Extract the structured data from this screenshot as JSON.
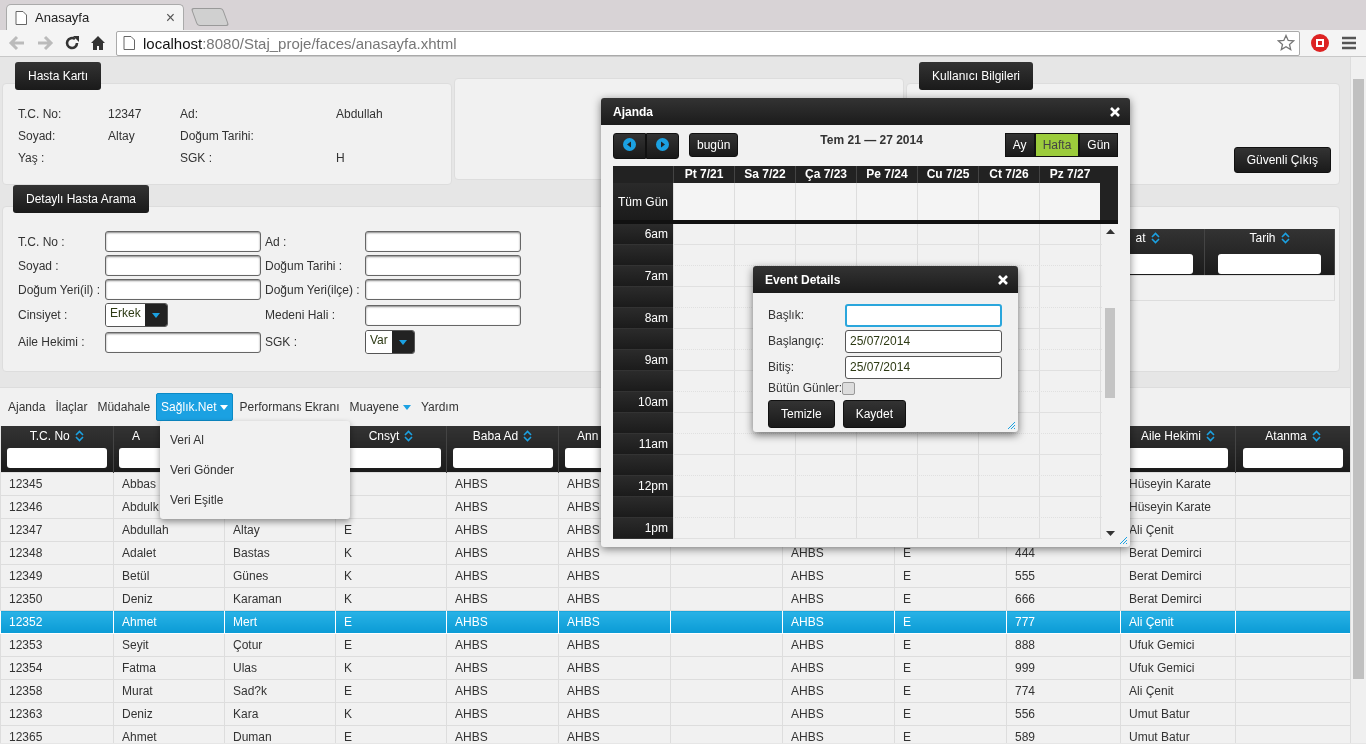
{
  "browser": {
    "tab": {
      "title": "Anasayfa",
      "close": "×"
    },
    "url": {
      "host": "localhost",
      "path": ":8080/Staj_proje/faces/anasayfa.xhtml"
    }
  },
  "patient_card": {
    "title": "Hasta Kartı",
    "fields": [
      {
        "label": "T.C. No:",
        "value": "12347"
      },
      {
        "label": "Ad:",
        "value": "Abdullah"
      },
      {
        "label": "Soyad:",
        "value": "Altay"
      },
      {
        "label": "Doğum Tarihi:"
      },
      {
        "label": "Yaş :"
      },
      {
        "label": "SGK :",
        "value": "H"
      }
    ]
  },
  "user_info": {
    "title": "Kullanıcı Bilgileri",
    "logout": "Güvenli Çıkış"
  },
  "search": {
    "title": "Detaylı Hasta Arama",
    "fields": [
      {
        "label": "T.C. No :",
        "kind": "text"
      },
      {
        "label": "Ad :",
        "kind": "text"
      },
      {
        "label": "Soyad :",
        "kind": "text"
      },
      {
        "label": "Doğum Tarihi :",
        "kind": "text"
      },
      {
        "label": "Doğum Yeri(il) :",
        "kind": "text"
      },
      {
        "label": "Doğum Yeri(ilçe) :",
        "kind": "text"
      },
      {
        "label": "Cinsiyet :",
        "kind": "select",
        "value": "Erkek"
      },
      {
        "label": "Medeni Hali :",
        "kind": "text"
      },
      {
        "label": "Aile Hekimi :",
        "kind": "text"
      },
      {
        "label": "SGK :",
        "kind": "select",
        "value": "Var"
      }
    ],
    "side_table": {
      "columns": [
        {
          "label": "at"
        },
        {
          "label": "Tarih"
        }
      ]
    }
  },
  "menu": {
    "items": [
      {
        "label": "Ajanda",
        "selected": false,
        "submenu": false
      },
      {
        "label": "İlaçlar",
        "selected": false,
        "submenu": false
      },
      {
        "label": "Müdahale",
        "selected": false,
        "submenu": false
      },
      {
        "label": "Sağlık.Net",
        "selected": true,
        "submenu": true
      },
      {
        "label": "Performans Ekranı",
        "selected": false,
        "submenu": false
      },
      {
        "label": "Muayene",
        "selected": false,
        "submenu": true
      },
      {
        "label": "Yardım",
        "selected": false,
        "submenu": false
      }
    ],
    "dropdown": [
      "Veri Al",
      "Veri Gönder",
      "Veri Eşitle"
    ]
  },
  "table": {
    "columns": [
      {
        "label": "T.C. No",
        "sort_icon": true
      },
      {
        "label": "A",
        "sort_icon": false
      },
      null,
      {
        "label": "Cnsyt",
        "sort_icon": true
      },
      {
        "label": "Baba Ad",
        "sort_icon": true
      },
      {
        "label": "Ann",
        "sort_icon": false
      },
      null,
      null,
      null,
      null,
      {
        "label": "Aile Hekimi",
        "sort_icon": true
      },
      {
        "label": "Atanma",
        "sort_icon": true
      }
    ],
    "rows": [
      {
        "selected": false,
        "cells": [
          "12345",
          "Abbas",
          null,
          null,
          "AHBS",
          "AHBS",
          null,
          null,
          null,
          null,
          "Hüseyin Karate",
          null
        ]
      },
      {
        "selected": false,
        "cells": [
          "12346",
          "Abdulk",
          null,
          null,
          "AHBS",
          "AHBS",
          null,
          null,
          null,
          null,
          "Hüseyin Karate",
          null
        ]
      },
      {
        "selected": false,
        "cells": [
          "12347",
          "Abdullah",
          "Altay",
          "E",
          "AHBS",
          "AHBS",
          null,
          null,
          null,
          null,
          "Ali Çenit",
          null
        ]
      },
      {
        "selected": false,
        "cells": [
          "12348",
          "Adalet",
          "Bastas",
          "K",
          "AHBS",
          "AHBS",
          null,
          "AHBS",
          "E",
          "444",
          "Berat Demirci",
          null
        ]
      },
      {
        "selected": false,
        "cells": [
          "12349",
          "Betül",
          "Günes",
          "K",
          "AHBS",
          "AHBS",
          null,
          "AHBS",
          "E",
          "555",
          "Berat Demirci",
          null
        ]
      },
      {
        "selected": false,
        "cells": [
          "12350",
          "Deniz",
          "Karaman",
          "K",
          "AHBS",
          "AHBS",
          null,
          "AHBS",
          "E",
          "666",
          "Berat Demirci",
          null
        ]
      },
      {
        "selected": true,
        "cells": [
          "12352",
          "Ahmet",
          "Mert",
          "E",
          "AHBS",
          "AHBS",
          null,
          "AHBS",
          "E",
          "777",
          "Ali Çenit",
          null
        ]
      },
      {
        "selected": false,
        "cells": [
          "12353",
          "Seyit",
          "Çotur",
          "E",
          "AHBS",
          "AHBS",
          null,
          "AHBS",
          "E",
          "888",
          "Ufuk Gemici",
          null
        ]
      },
      {
        "selected": false,
        "cells": [
          "12354",
          "Fatma",
          "Ulas",
          "K",
          "AHBS",
          "AHBS",
          null,
          "AHBS",
          "E",
          "999",
          "Ufuk Gemici",
          null
        ]
      },
      {
        "selected": false,
        "cells": [
          "12358",
          "Murat",
          "Sad?k",
          "E",
          "AHBS",
          "AHBS",
          null,
          "AHBS",
          "E",
          "774",
          "Ali Çenit",
          null
        ]
      },
      {
        "selected": false,
        "cells": [
          "12363",
          "Deniz",
          "Kara",
          "K",
          "AHBS",
          "AHBS",
          null,
          "AHBS",
          "E",
          "556",
          "Umut Batur",
          null
        ]
      },
      {
        "selected": false,
        "cells": [
          "12365",
          "Ahmet",
          "Duman",
          "E",
          "AHBS",
          "AHBS",
          null,
          "AHBS",
          "E",
          "589",
          "Umut Batur",
          null
        ]
      }
    ]
  },
  "agenda": {
    "title": "Ajanda",
    "today": "bugün",
    "range": "Tem 21 — 27 2014",
    "views": [
      {
        "label": "Ay",
        "selected": false
      },
      {
        "label": "Hafta",
        "selected": true
      },
      {
        "label": "Gün",
        "selected": false
      }
    ],
    "days": [
      "Pt 7/21",
      "Sa 7/22",
      "Ça 7/23",
      "Pe 7/24",
      "Cu 7/25",
      "Ct 7/26",
      "Pz 7/27"
    ],
    "all_day": "Tüm Gün",
    "hours": [
      "6am",
      "7am",
      "8am",
      "9am",
      "10am",
      "11am",
      "12pm",
      "1pm"
    ]
  },
  "event_dialog": {
    "title": "Event Details",
    "fields": [
      {
        "label": "Başlık:",
        "focused": true
      },
      {
        "label": "Başlangıç:",
        "value": "25/07/2014",
        "focused": false
      },
      {
        "label": "Bitiş:",
        "value": "25/07/2014",
        "focused": false
      }
    ],
    "all_days": {
      "label": "Bütün Günler:",
      "checked": false
    },
    "buttons": [
      "Temizle",
      "Kaydet"
    ]
  }
}
